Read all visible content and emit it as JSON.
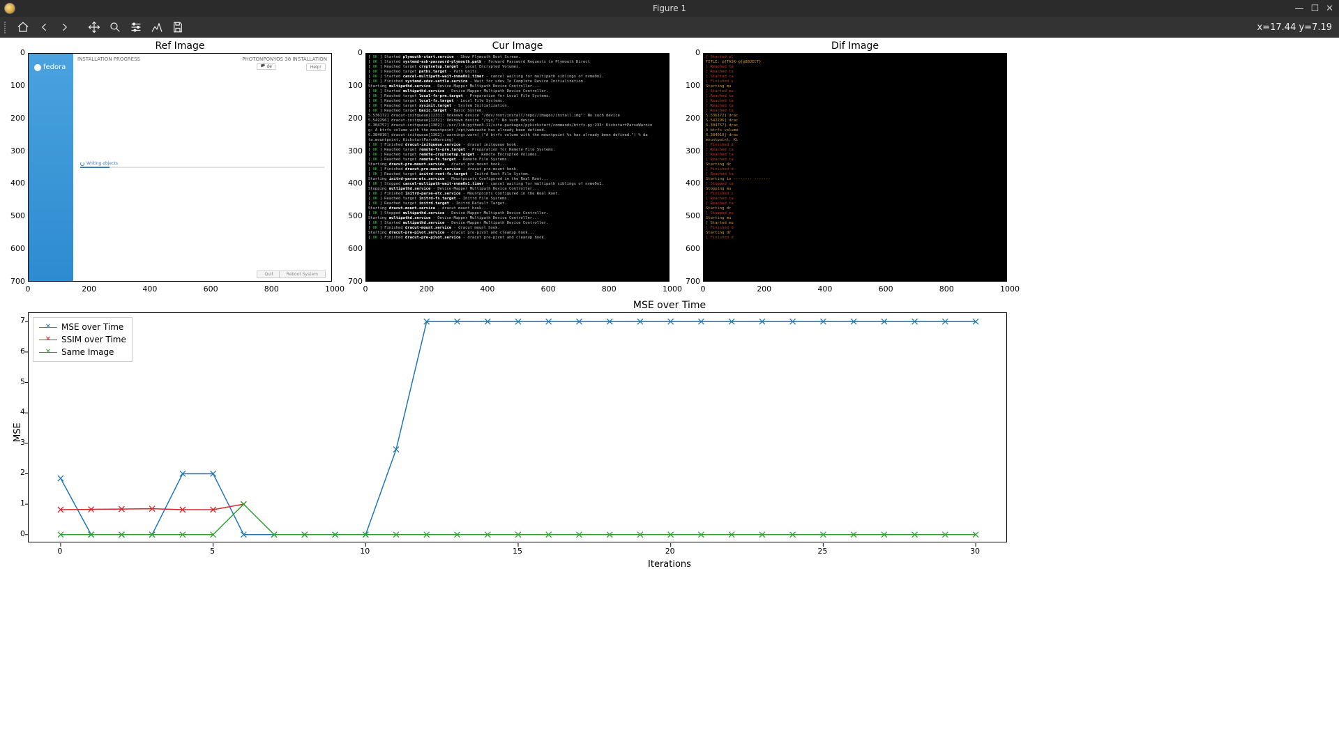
{
  "window": {
    "title": "Figure 1"
  },
  "toolbar": {
    "coord_readout": "x=17.44 y=7.19"
  },
  "subplots": {
    "ref": {
      "title": "Ref Image",
      "x_ticks": [
        0,
        200,
        400,
        600,
        800,
        1000
      ],
      "y_ticks": [
        0,
        100,
        200,
        300,
        400,
        500,
        600,
        700
      ]
    },
    "cur": {
      "title": "Cur Image",
      "x_ticks": [
        0,
        200,
        400,
        600,
        800,
        1000
      ],
      "y_ticks": [
        0,
        100,
        200,
        300,
        400,
        500,
        600,
        700
      ]
    },
    "dif": {
      "title": "Dif Image",
      "x_ticks": [
        0,
        200,
        400,
        600,
        800,
        1000
      ],
      "y_ticks": [
        0,
        100,
        200,
        300,
        400,
        500,
        600,
        700
      ]
    }
  },
  "ref_image": {
    "header_left": "INSTALLATION PROGRESS",
    "header_right": "PHOTONPONYOS 38 INSTALLATION",
    "brand": "fedora",
    "lang": "de",
    "help": "Help!",
    "status": "Writing objects",
    "btn_quit": "Quit",
    "btn_reboot": "Reboot System"
  },
  "cur_image": {
    "lines": [
      {
        "s": "OK",
        "t": "] Started ",
        "b": "plymouth-start.service",
        "r": " - Show Plymouth Boot Screen."
      },
      {
        "s": "OK",
        "t": "] Started ",
        "b": "systemd-ask-password-plymouth.path",
        "r": " - Forward Password Requests to Plymouth Direct"
      },
      {
        "s": "OK",
        "t": "] Reached target ",
        "b": "cryptsetup.target",
        "r": " - Local Encrypted Volumes."
      },
      {
        "s": "OK",
        "t": "] Reached target ",
        "b": "paths.target",
        "r": " - Path Units."
      },
      {
        "s": "OK",
        "t": "] Started ",
        "b": "cancel-multipath-wait-nvme0n1.timer",
        "r": " - cancel waiting for multipath siblings of nvme0n1."
      },
      {
        "s": "OK",
        "t": "] Finished ",
        "b": "systemd-udev-settle.service",
        "r": " - Wait for udev To Complete Device Initialization."
      },
      {
        "s": "",
        "t": "       Starting ",
        "b": "multipathd.service",
        "r": " - Device-Mapper Multipath Device Controller..."
      },
      {
        "s": "OK",
        "t": "] Started ",
        "b": "multipathd.service",
        "r": " - Device-Mapper Multipath Device Controller."
      },
      {
        "s": "OK",
        "t": "] Reached target ",
        "b": "local-fs-pre.target",
        "r": " - Preparation for Local File Systems."
      },
      {
        "s": "OK",
        "t": "] Reached target ",
        "b": "local-fs.target",
        "r": " - Local File Systems."
      },
      {
        "s": "OK",
        "t": "] Reached target ",
        "b": "sysinit.target",
        "r": " - System Initialization."
      },
      {
        "s": "OK",
        "t": "] Reached target ",
        "b": "basic.target",
        "r": " - Basic System."
      },
      {
        "s": "",
        "t": "   5.536172] dracut-initqueue[1233]: Unknown device \"/dev/root/install/repo//images/install.img\": No such device",
        "b": "",
        "r": ""
      },
      {
        "s": "",
        "t": "   5.542296] dracut-initqueue[1232]: Unknown device \"/sys/\": No such device",
        "b": "",
        "r": ""
      },
      {
        "s": "",
        "t": "   6.304757] dracut-initqueue[1302]: /usr/lib/python3.11/site-packages/pykickstart/commands/btrfs.py:233: KickstartParseWarnin",
        "b": "",
        "r": ""
      },
      {
        "s": "",
        "t": "g: A btrfs volume with the mountpoint /opt/webcache has already been defined.",
        "b": "",
        "r": ""
      },
      {
        "s": "",
        "t": "   6.384010] dracut-initqueue[1302]:   warnings.warn(_(\"A btrfs volume with the mountpoint %s has already been defined.\") % da",
        "b": "",
        "r": ""
      },
      {
        "s": "",
        "t": "ta.mountpoint, KickstartParseWarning)",
        "b": "",
        "r": ""
      },
      {
        "s": "OK",
        "t": "] Finished ",
        "b": "dracut-initqueue.service",
        "r": " - dracut initqueue hook."
      },
      {
        "s": "OK",
        "t": "] Reached target ",
        "b": "remote-fs-pre.target",
        "r": " - Preparation for Remote File Systems."
      },
      {
        "s": "OK",
        "t": "] Reached target ",
        "b": "remote-cryptsetup.target",
        "r": " - Remote Encrypted Volumes."
      },
      {
        "s": "OK",
        "t": "] Reached target ",
        "b": "remote-fs.target",
        "r": " - Remote File Systems."
      },
      {
        "s": "",
        "t": "       Starting ",
        "b": "dracut-pre-mount.service",
        "r": " - dracut pre-mount hook..."
      },
      {
        "s": "OK",
        "t": "] Finished ",
        "b": "dracut-pre-mount.service",
        "r": " - dracut pre-mount hook."
      },
      {
        "s": "OK",
        "t": "] Reached target ",
        "b": "initrd-root-fs.target",
        "r": " - Initrd Root File System."
      },
      {
        "s": "",
        "t": "       Starting ",
        "b": "initrd-parse-etc.service",
        "r": " - Mountpoints Configured in the Real Root..."
      },
      {
        "s": "OK",
        "t": "] Stopped ",
        "b": "cancel-multipath-wait-nvme0n1.timer",
        "r": " - cancel waiting for multipath siblings of nvme0n1."
      },
      {
        "s": "",
        "t": "       Stopping ",
        "b": "multipathd.service",
        "r": " - Device-Mapper Multipath Device Controller..."
      },
      {
        "s": "OK",
        "t": "] Finished ",
        "b": "initrd-parse-etc.service",
        "r": " - Mountpoints Configured in the Real Root."
      },
      {
        "s": "OK",
        "t": "] Reached target ",
        "b": "initrd-fs.target",
        "r": " - Initrd File Systems."
      },
      {
        "s": "OK",
        "t": "] Reached target ",
        "b": "initrd.target",
        "r": " - Initrd Default Target."
      },
      {
        "s": "",
        "t": "       Starting ",
        "b": "dracut-mount.service",
        "r": " - dracut mount hook..."
      },
      {
        "s": "OK",
        "t": "] Stopped ",
        "b": "multipathd.service",
        "r": " - Device-Mapper Multipath Device Controller."
      },
      {
        "s": "",
        "t": "       Starting ",
        "b": "multipathd.service",
        "r": " - Device-Mapper Multipath Device Controller..."
      },
      {
        "s": "OK",
        "t": "] Started ",
        "b": "multipathd.service",
        "r": " - Device-Mapper Multipath Device Controller."
      },
      {
        "s": "OK",
        "t": "] Finished ",
        "b": "dracut-mount.service",
        "r": " - dracut mount hook."
      },
      {
        "s": "",
        "t": "       Starting ",
        "b": "dracut-pre-pivot.service",
        "r": " - dracut pre-pivot and cleanup hook..."
      },
      {
        "s": "OK",
        "t": "] Finished ",
        "b": "dracut-pre-pivot.service",
        "r": " - dracut pre-pivot and cleanup hook."
      }
    ]
  },
  "dif_image": {
    "lines": [
      {
        "c": "r",
        "t": "] Started pl"
      },
      {
        "c": "a",
        "t": "TITLE: @{TASK-@{@OBJECT}"
      },
      {
        "c": "r",
        "t": "] Reached ta"
      },
      {
        "c": "r",
        "t": "] Reached ta"
      },
      {
        "c": "r",
        "t": "] Started ca"
      },
      {
        "c": "r",
        "t": "] Finished s"
      },
      {
        "c": "a",
        "t": "   Starting mu"
      },
      {
        "c": "r",
        "t": "] Started mu"
      },
      {
        "c": "r",
        "t": "] Reached ta"
      },
      {
        "c": "r",
        "t": "] Reached ta"
      },
      {
        "c": "r",
        "t": "] Reached ta"
      },
      {
        "c": "r",
        "t": "] Reached ta"
      },
      {
        "c": "a",
        "t": "5.536172] drac"
      },
      {
        "c": "a",
        "t": "5.542296] drac"
      },
      {
        "c": "a",
        "t": "6.304757] drac"
      },
      {
        "c": "a",
        "t": "A btrfs volume"
      },
      {
        "c": "a",
        "t": "6.384010] drac"
      },
      {
        "c": "a",
        "t": "mountpoint, Ki"
      },
      {
        "c": "r",
        "t": "] Finished d"
      },
      {
        "c": "r",
        "t": "] Reached ta"
      },
      {
        "c": "r",
        "t": "] Reached ta"
      },
      {
        "c": "r",
        "t": "] Reached ta"
      },
      {
        "c": "a",
        "t": "   Starting dr"
      },
      {
        "c": "r",
        "t": "] Finished d"
      },
      {
        "c": "r",
        "t": "] Reached ta"
      },
      {
        "c": "a",
        "t": "   Starting in    -------- -------"
      },
      {
        "c": "r",
        "t": "] Stopped ca"
      },
      {
        "c": "a",
        "t": "   Stopping mu"
      },
      {
        "c": "r",
        "t": "] Finished i"
      },
      {
        "c": "r",
        "t": "] Reached ta"
      },
      {
        "c": "r",
        "t": "] Reached ta"
      },
      {
        "c": "a",
        "t": "   Starting dr"
      },
      {
        "c": "r",
        "t": "] Stopped mu"
      },
      {
        "c": "a",
        "t": "   Starting mu"
      },
      {
        "c": "a",
        "t": "] Started mu"
      },
      {
        "c": "r",
        "t": "] Finished d"
      },
      {
        "c": "a",
        "t": "   Starting dr"
      },
      {
        "c": "r",
        "t": "] Finished d"
      }
    ]
  },
  "chart_data": {
    "type": "line",
    "title": "MSE over Time",
    "xlabel": "Iterations",
    "ylabel": "MSE",
    "xlim": [
      0,
      30
    ],
    "ylim": [
      0,
      7
    ],
    "x_ticks": [
      0,
      5,
      10,
      15,
      20,
      25,
      30
    ],
    "y_ticks": [
      0,
      1,
      2,
      3,
      4,
      5,
      6,
      7
    ],
    "x": [
      0,
      1,
      2,
      3,
      4,
      5,
      6,
      7,
      8,
      9,
      10,
      11,
      12,
      13,
      14,
      15,
      16,
      17,
      18,
      19,
      20,
      21,
      22,
      23,
      24,
      25,
      26,
      27,
      28,
      29,
      30
    ],
    "series": [
      {
        "name": "MSE over Time",
        "color": "#1f77b4",
        "values": [
          1.85,
          0,
          0,
          0,
          2,
          2,
          0,
          0,
          0,
          0,
          0,
          2.8,
          7,
          7,
          7,
          7,
          7,
          7,
          7,
          7,
          7,
          7,
          7,
          7,
          7,
          7,
          7,
          7,
          7,
          7,
          7
        ]
      },
      {
        "name": "SSIM over Time",
        "color": "#d62728",
        "values": [
          0.82,
          0.83,
          0.84,
          0.85,
          0.82,
          0.82,
          1,
          null,
          null,
          null,
          null,
          null,
          null,
          null,
          null,
          null,
          null,
          null,
          null,
          null,
          null,
          null,
          null,
          null,
          null,
          null,
          null,
          null,
          null,
          null,
          null
        ]
      },
      {
        "name": "Same Image",
        "color": "#2ca02c",
        "values": [
          0,
          0,
          0,
          0,
          0,
          0,
          1,
          0,
          0,
          0,
          0,
          0,
          0,
          0,
          0,
          0,
          0,
          0,
          0,
          0,
          0,
          0,
          0,
          0,
          0,
          0,
          0,
          0,
          0,
          0,
          0
        ]
      }
    ],
    "legend_position": "upper-left"
  }
}
